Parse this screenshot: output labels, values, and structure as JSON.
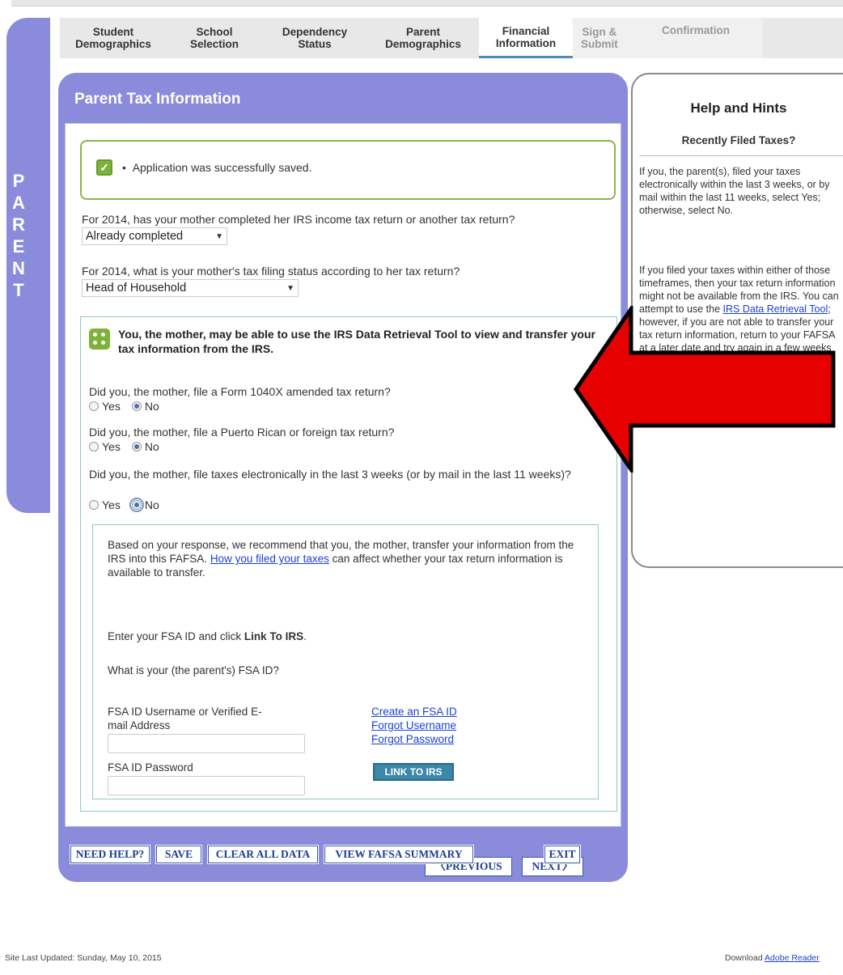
{
  "side_label": [
    "P",
    "A",
    "R",
    "E",
    "N",
    "T"
  ],
  "tabs": [
    {
      "line1": "Student",
      "line2": "Demographics"
    },
    {
      "line1": "School",
      "line2": "Selection"
    },
    {
      "line1": "Dependency",
      "line2": "Status"
    },
    {
      "line1": "Parent",
      "line2": "Demographics"
    },
    {
      "line1": "Financial",
      "line2": "Information"
    },
    {
      "line1": "Sign &",
      "line2": "Submit"
    },
    {
      "line1": "Confirmation",
      "line2": ""
    }
  ],
  "panel": {
    "title": "Parent Tax Information",
    "saved_message": "Application was successfully saved.",
    "q1": "For 2014, has your mother completed her IRS income tax return or another tax return?",
    "q1_value": "Already completed",
    "q2": "For 2014, what is your mother's tax filing status according to her tax return?",
    "q2_value": "Head of Household",
    "drt_heading": "You, the mother, may be able to use the IRS Data Retrieval Tool to view and transfer your tax information from the IRS.",
    "q3": "Did you, the mother, file a Form 1040X amended tax return?",
    "q4": "Did you, the mother, file a Puerto Rican or foreign tax return?",
    "q5": "Did you, the mother, file taxes electronically in the last 3 weeks (or by mail in the last 11 weeks)?",
    "yes": "Yes",
    "no": "No",
    "rec_text_1": "Based on your response, we recommend that you, the mother, transfer your information from the IRS into this FAFSA.",
    "rec_link": "How you filed your taxes",
    "rec_text_2": "can affect whether your tax return information is available to transfer.",
    "enter_prefix": "Enter your FSA ID and click",
    "enter_bold": "Link To IRS",
    "fsa_question": "What is your (the parent's) FSA ID?",
    "username_label": "FSA ID Username or Verified E-mail Address",
    "password_label": "FSA ID Password",
    "link_create": "Create an FSA ID",
    "link_forgot_user": "Forgot Username",
    "link_forgot_pass": "Forgot Password",
    "link_to_irs": "LINK TO IRS",
    "previous": "PREVIOUS",
    "next": "NEXT"
  },
  "bottom": {
    "need_help": "NEED HELP?",
    "save": "SAVE",
    "clear": "CLEAR ALL DATA",
    "view": "VIEW FAFSA SUMMARY",
    "exit": "EXIT"
  },
  "help": {
    "title": "Help and Hints",
    "subtitle": "Recently Filed Taxes?",
    "p1": "If you, the parent(s), filed your taxes electronically within the last 3 weeks, or by mail within the last 11 weeks, select Yes; otherwise, select No.",
    "p2a": "If you filed your taxes within either of those timeframes, then your tax return information might not be available from the IRS. You can attempt to use the",
    "p2_link": "IRS Data Retrieval Tool",
    "p2b": "; however, if you are not able to transfer your tax return information, return to your FAFSA at a later date and try again in a few weeks or you can manually enter your tax return information."
  },
  "footer": {
    "left": "Site Last Updated: Sunday, May 10, 2015",
    "right_prefix": "Download",
    "right_link": "Adobe Reader"
  },
  "colors": {
    "panel": "#8b8bdc",
    "success": "#7fb23a",
    "link": "#1a3fd6",
    "arrow": "#e60000",
    "button_blue": "#3b88a8"
  }
}
